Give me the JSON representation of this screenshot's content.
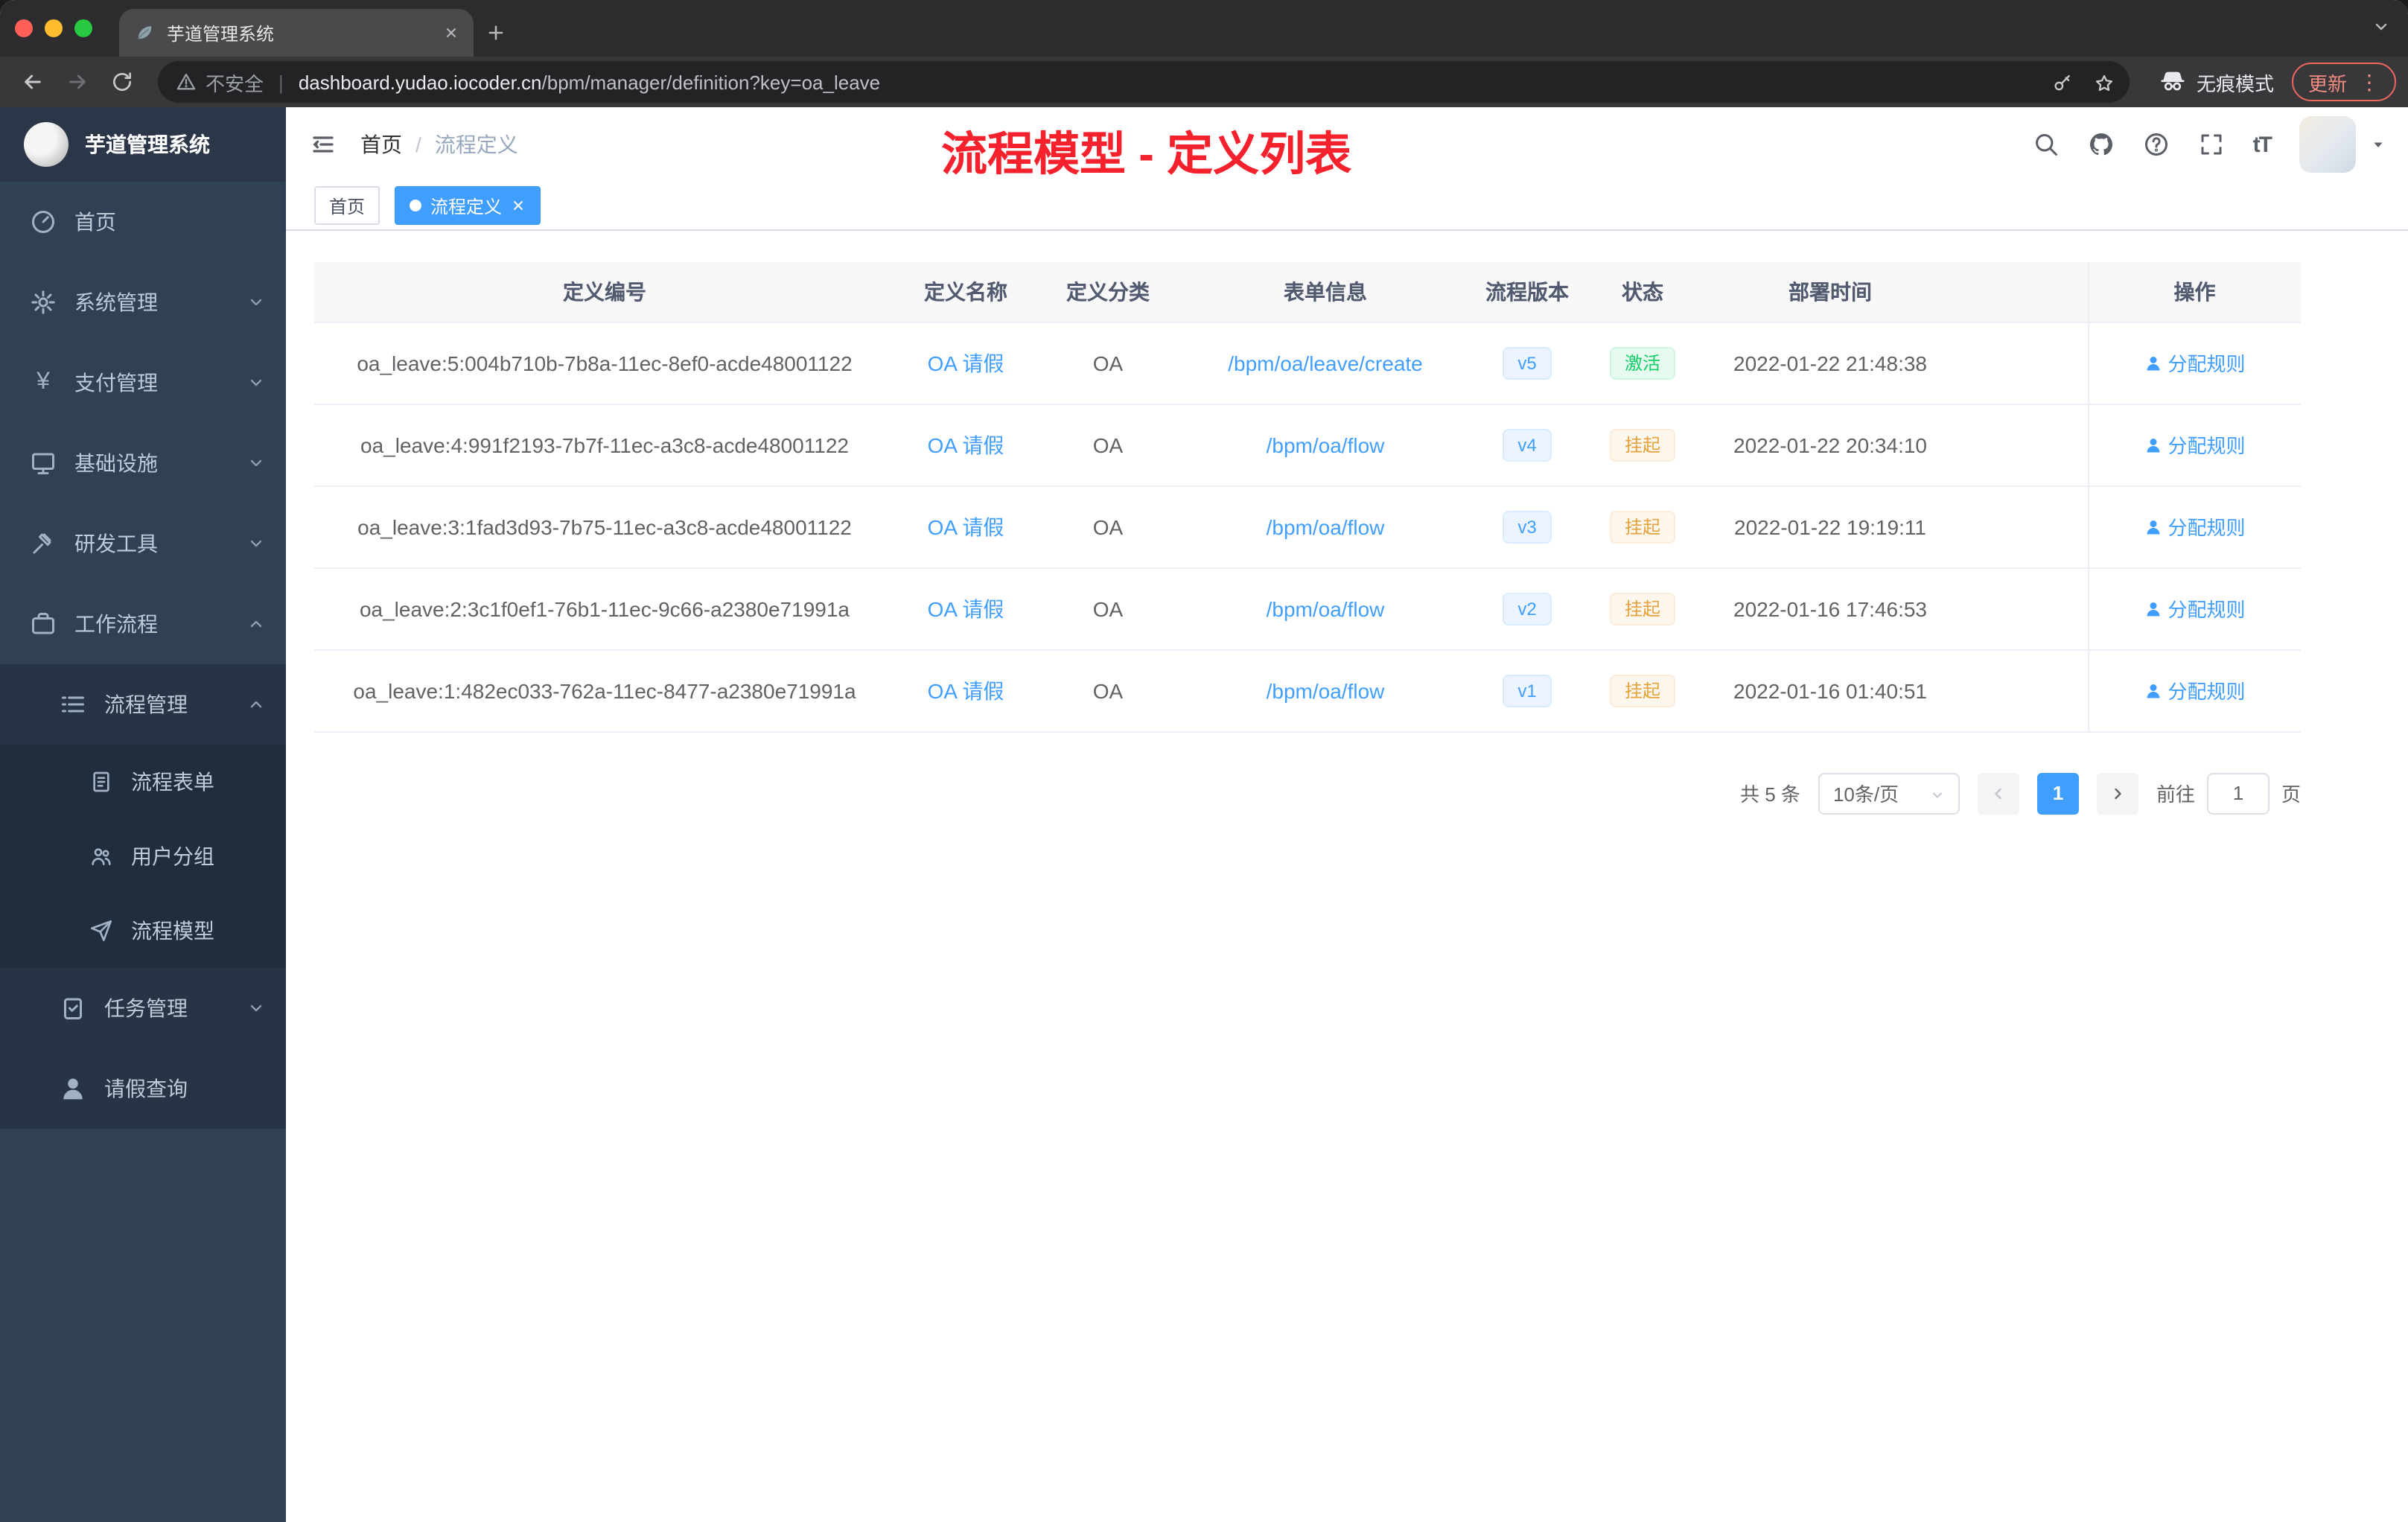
{
  "browser": {
    "tab": {
      "title": "芋道管理系统"
    },
    "address": {
      "security_label": "不安全",
      "host": "dashboard.yudao.iocoder.cn",
      "path": "/bpm/manager/definition?key=oa_leave"
    },
    "incognito_label": "无痕模式",
    "update_label": "更新",
    "menu_dots": "⋮"
  },
  "sidebar": {
    "app_title": "芋道管理系统",
    "items": [
      {
        "label": "首页",
        "icon": "dashboard",
        "level": 1
      },
      {
        "label": "系统管理",
        "icon": "gear",
        "level": 1,
        "chevron": "down"
      },
      {
        "label": "支付管理",
        "icon": "yen",
        "glyph": "¥",
        "level": 1,
        "chevron": "down"
      },
      {
        "label": "基础设施",
        "icon": "monitor",
        "level": 1,
        "chevron": "down"
      },
      {
        "label": "研发工具",
        "icon": "tools",
        "level": 1,
        "chevron": "down"
      },
      {
        "label": "工作流程",
        "icon": "briefcase",
        "level": 1,
        "chevron": "up"
      },
      {
        "label": "流程管理",
        "icon": "list",
        "level": 2,
        "chevron": "up"
      },
      {
        "label": "流程表单",
        "icon": "document",
        "level": 3
      },
      {
        "label": "用户分组",
        "icon": "users",
        "level": 3
      },
      {
        "label": "流程模型",
        "icon": "send",
        "level": 3
      },
      {
        "label": "任务管理",
        "icon": "clipboard",
        "level": 2,
        "chevron": "down"
      },
      {
        "label": "请假查询",
        "icon": "person",
        "level": 2
      }
    ]
  },
  "header": {
    "breadcrumb": {
      "root": "首页",
      "separator": "/",
      "current": "流程定义"
    },
    "annotation": "流程模型 - 定义列表",
    "action_icons": [
      "search",
      "github",
      "question",
      "fullscreen",
      "font-size",
      "avatar"
    ],
    "font_size_icon_text": "tT"
  },
  "tags": {
    "home": "首页",
    "active": "流程定义"
  },
  "table": {
    "columns": {
      "id": "定义编号",
      "name": "定义名称",
      "category": "定义分类",
      "form": "表单信息",
      "version": "流程版本",
      "status": "状态",
      "time": "部署时间",
      "actions": "操作"
    },
    "rows": [
      {
        "id": "oa_leave:5:004b710b-7b8a-11ec-8ef0-acde48001122",
        "name": "OA 请假",
        "category": "OA",
        "form": "/bpm/oa/leave/create",
        "version": "v5",
        "status": "激活",
        "status_type": "success",
        "time": "2022-01-22 21:48:38",
        "action": "分配规则"
      },
      {
        "id": "oa_leave:4:991f2193-7b7f-11ec-a3c8-acde48001122",
        "name": "OA 请假",
        "category": "OA",
        "form": "/bpm/oa/flow",
        "version": "v4",
        "status": "挂起",
        "status_type": "warning",
        "time": "2022-01-22 20:34:10",
        "action": "分配规则"
      },
      {
        "id": "oa_leave:3:1fad3d93-7b75-11ec-a3c8-acde48001122",
        "name": "OA 请假",
        "category": "OA",
        "form": "/bpm/oa/flow",
        "version": "v3",
        "status": "挂起",
        "status_type": "warning",
        "time": "2022-01-22 19:19:11",
        "action": "分配规则"
      },
      {
        "id": "oa_leave:2:3c1f0ef1-76b1-11ec-9c66-a2380e71991a",
        "name": "OA 请假",
        "category": "OA",
        "form": "/bpm/oa/flow",
        "version": "v2",
        "status": "挂起",
        "status_type": "warning",
        "time": "2022-01-16 17:46:53",
        "action": "分配规则"
      },
      {
        "id": "oa_leave:1:482ec033-762a-11ec-8477-a2380e71991a",
        "name": "OA 请假",
        "category": "OA",
        "form": "/bpm/oa/flow",
        "version": "v1",
        "status": "挂起",
        "status_type": "warning",
        "time": "2022-01-16 01:40:51",
        "action": "分配规则"
      }
    ]
  },
  "pagination": {
    "total": "共 5 条",
    "page_size": "10条/页",
    "current_page": "1",
    "goto_label": "前往",
    "goto_value": "1",
    "page_unit": "页"
  },
  "colors": {
    "accent": "#409eff",
    "annotation_red": "#f5222d",
    "success_green": "#13ce66",
    "warning_orange": "#e6a23c",
    "sidebar_bg": "#304156"
  }
}
